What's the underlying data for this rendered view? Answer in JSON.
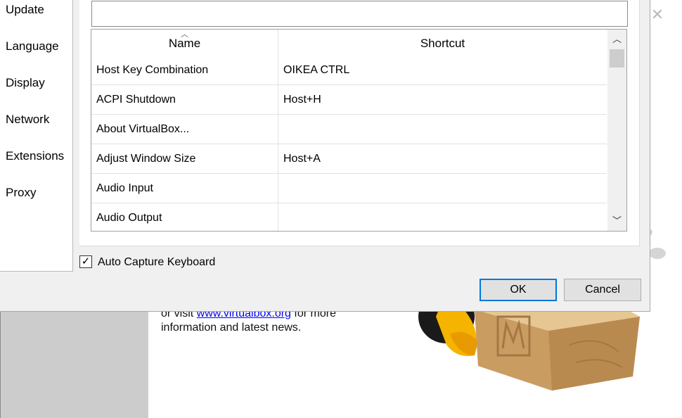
{
  "sidebar": {
    "items": [
      {
        "label": "Update"
      },
      {
        "label": "Language"
      },
      {
        "label": "Display"
      },
      {
        "label": "Network"
      },
      {
        "label": "Extensions"
      },
      {
        "label": "Proxy"
      }
    ]
  },
  "filter": {
    "value": "",
    "placeholder": ""
  },
  "table": {
    "columns": {
      "name": "Name",
      "shortcut": "Shortcut"
    },
    "sort_column": "Name",
    "rows": [
      {
        "name": "Host Key Combination",
        "shortcut": "OIKEA CTRL"
      },
      {
        "name": "ACPI Shutdown",
        "shortcut": "Host+H"
      },
      {
        "name": "About VirtualBox...",
        "shortcut": ""
      },
      {
        "name": "Adjust Window Size",
        "shortcut": "Host+A"
      },
      {
        "name": "Audio Input",
        "shortcut": ""
      },
      {
        "name": "Audio Output",
        "shortcut": ""
      }
    ]
  },
  "auto_capture": {
    "label": "Auto Capture Keyboard",
    "checked": true,
    "mark": "✓"
  },
  "buttons": {
    "ok": "OK",
    "cancel": "Cancel"
  },
  "background": {
    "text_prefix": "or visit ",
    "link": "www.virtualbox.org",
    "text_suffix": " for more",
    "line2": "information and latest news.",
    "close_glyph": "✕"
  },
  "colors": {
    "accent": "#0078d7",
    "link": "#0000ee",
    "dialog_bg": "#f0f0f0"
  }
}
